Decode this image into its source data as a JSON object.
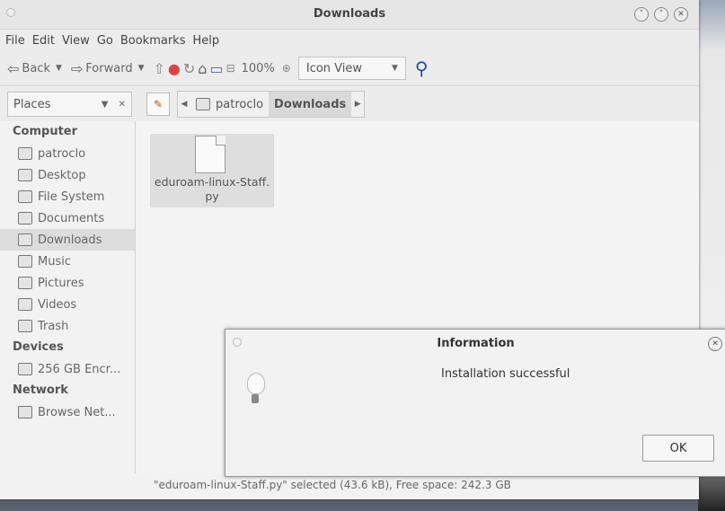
{
  "window": {
    "title": "Downloads"
  },
  "menu": [
    "File",
    "Edit",
    "View",
    "Go",
    "Bookmarks",
    "Help"
  ],
  "toolbar": {
    "back_label": "Back",
    "forward_label": "Forward",
    "zoom": "100%",
    "view_mode": "Icon View"
  },
  "location": {
    "places_label": "Places",
    "crumbs": [
      "patroclo",
      "Downloads"
    ]
  },
  "sidebar": {
    "computer_heading": "Computer",
    "computer_items": [
      "patroclo",
      "Desktop",
      "File System",
      "Documents",
      "Downloads",
      "Music",
      "Pictures",
      "Videos",
      "Trash"
    ],
    "devices_heading": "Devices",
    "devices_items": [
      "256 GB Encr..."
    ],
    "network_heading": "Network",
    "network_items": [
      "Browse Net..."
    ]
  },
  "files": [
    {
      "name_line1": "eduroam-linux-Staff.",
      "name_line2": "py"
    }
  ],
  "status": "\"eduroam-linux-Staff.py\" selected (43.6 kB), Free space: 242.3 GB",
  "dialog": {
    "title": "Information",
    "message": "Installation successful",
    "ok_label": "OK"
  }
}
